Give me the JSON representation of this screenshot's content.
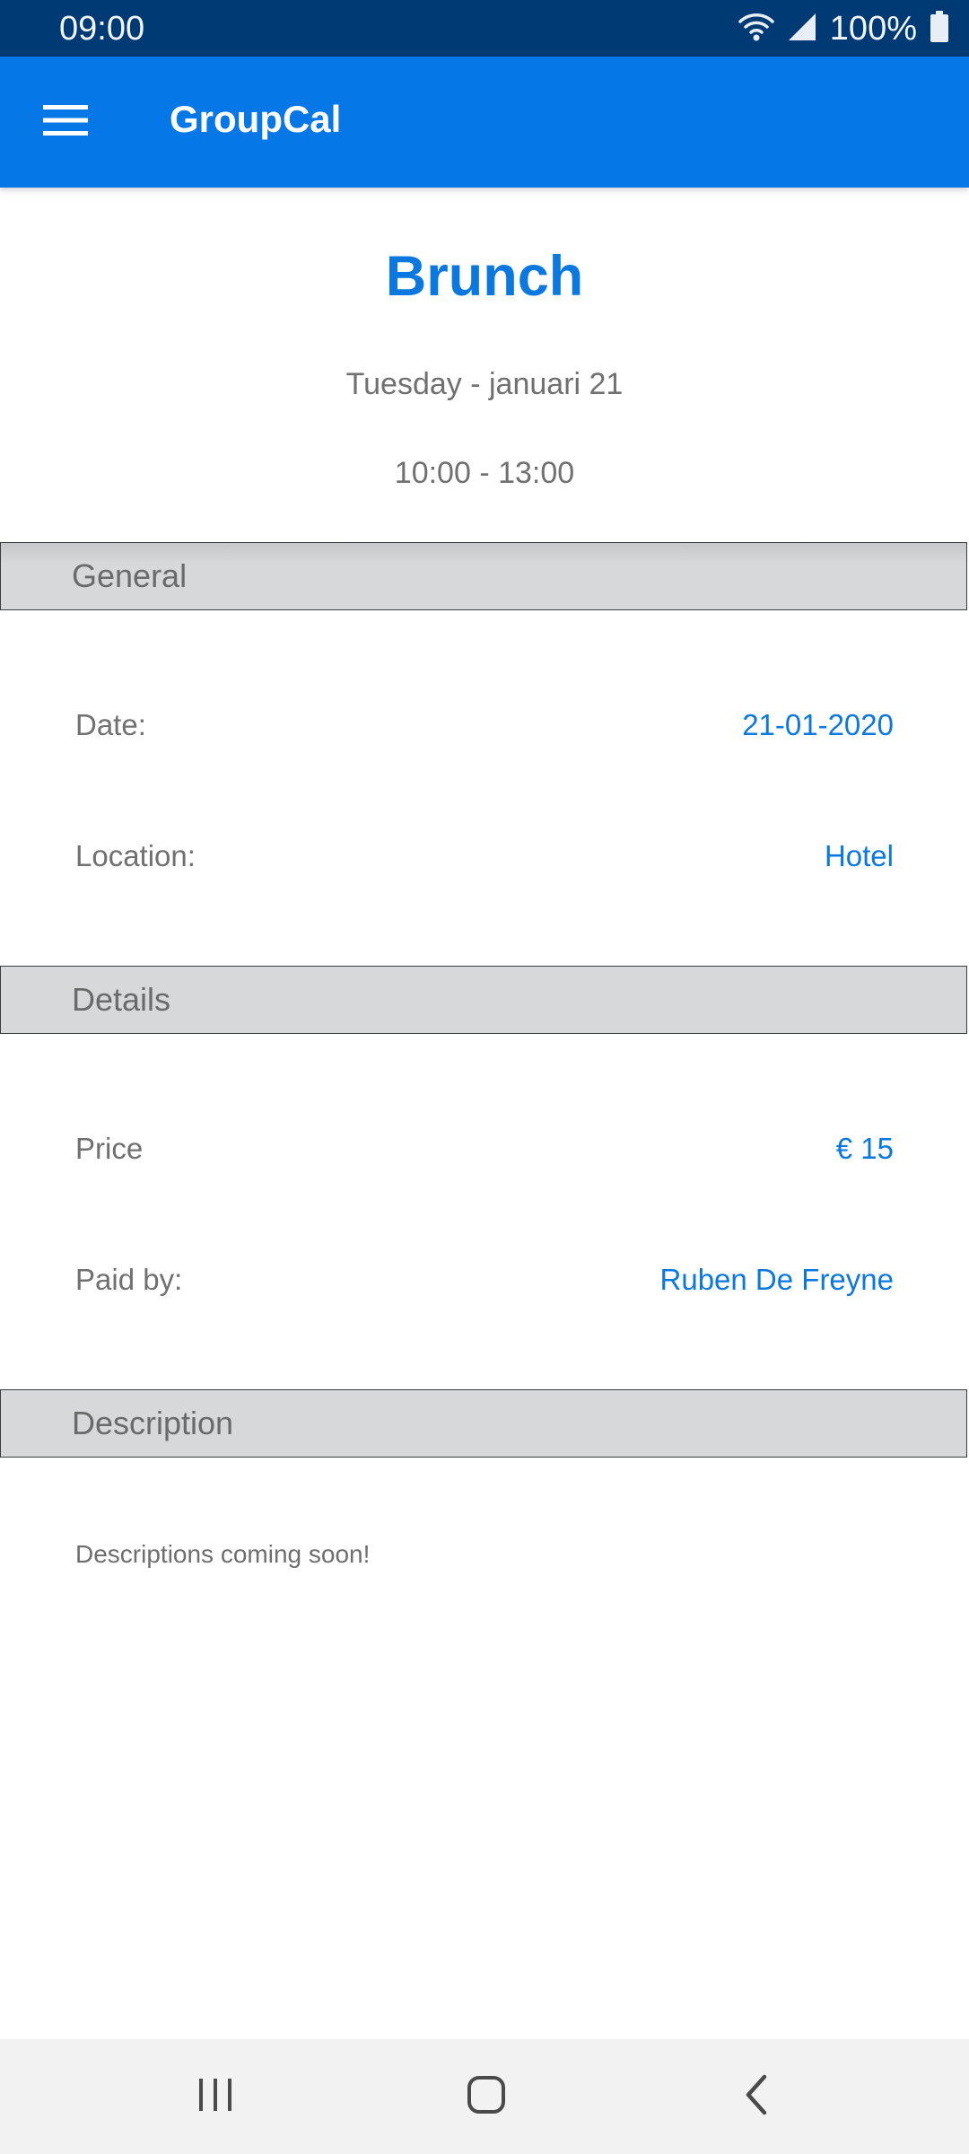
{
  "status_bar": {
    "time": "09:00",
    "battery": "100%",
    "icons": [
      "wifi-icon",
      "signal-icon",
      "battery-icon"
    ]
  },
  "app_bar": {
    "title": "GroupCal",
    "menu_icon": "hamburger-menu-icon",
    "background_color": "#0677e6"
  },
  "event": {
    "title": "Brunch",
    "date_line": "Tuesday - januari 21",
    "time_line": "10:00 - 13:00"
  },
  "sections": {
    "general": {
      "label": "General",
      "rows": [
        {
          "label": "Date:",
          "value": "21-01-2020"
        },
        {
          "label": "Location:",
          "value": "Hotel"
        }
      ]
    },
    "details": {
      "label": "Details",
      "rows": [
        {
          "label": "Price",
          "value": "€ 15"
        },
        {
          "label": "Paid by:",
          "value": "Ruben De Freyne"
        }
      ]
    },
    "description": {
      "label": "Description",
      "text": "Descriptions coming soon!"
    }
  },
  "nav_bar": {
    "buttons": [
      "recent-apps-icon",
      "home-icon",
      "back-icon"
    ]
  },
  "colors": {
    "accent": "#0b78e0",
    "status_bar": "#003a75",
    "section_header": "#d7d8d9",
    "secondary_text": "#707070"
  }
}
